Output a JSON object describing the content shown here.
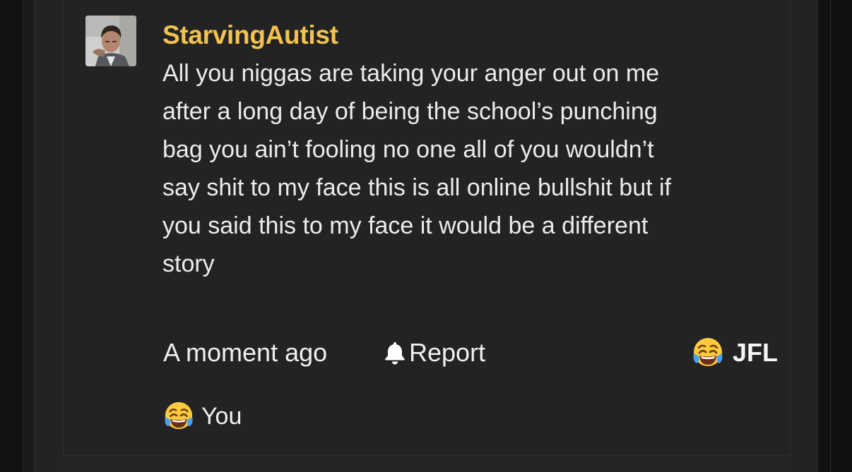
{
  "comment": {
    "author": "StarvingAutist",
    "avatar_icon": "user-avatar-photo",
    "body": "All you niggas are taking your anger out on me\nafter a long day of being the school’s punching\nbag you ain’t fooling no one all of you wouldn’t\nsay shit to my face this is all online bullshit but if\nyou said this to my face it would be a different\nstory",
    "timestamp": "A moment ago",
    "report_label": "Report",
    "report_icon": "bell-icon",
    "reaction": {
      "emoji_icon": "face-with-tears-of-joy-icon",
      "label": "JFL"
    },
    "reactors": {
      "emoji_icon": "face-with-tears-of-joy-icon",
      "label": "You"
    }
  },
  "colors": {
    "background": "#232323",
    "username": "#f2c14e",
    "text": "#ececec"
  }
}
